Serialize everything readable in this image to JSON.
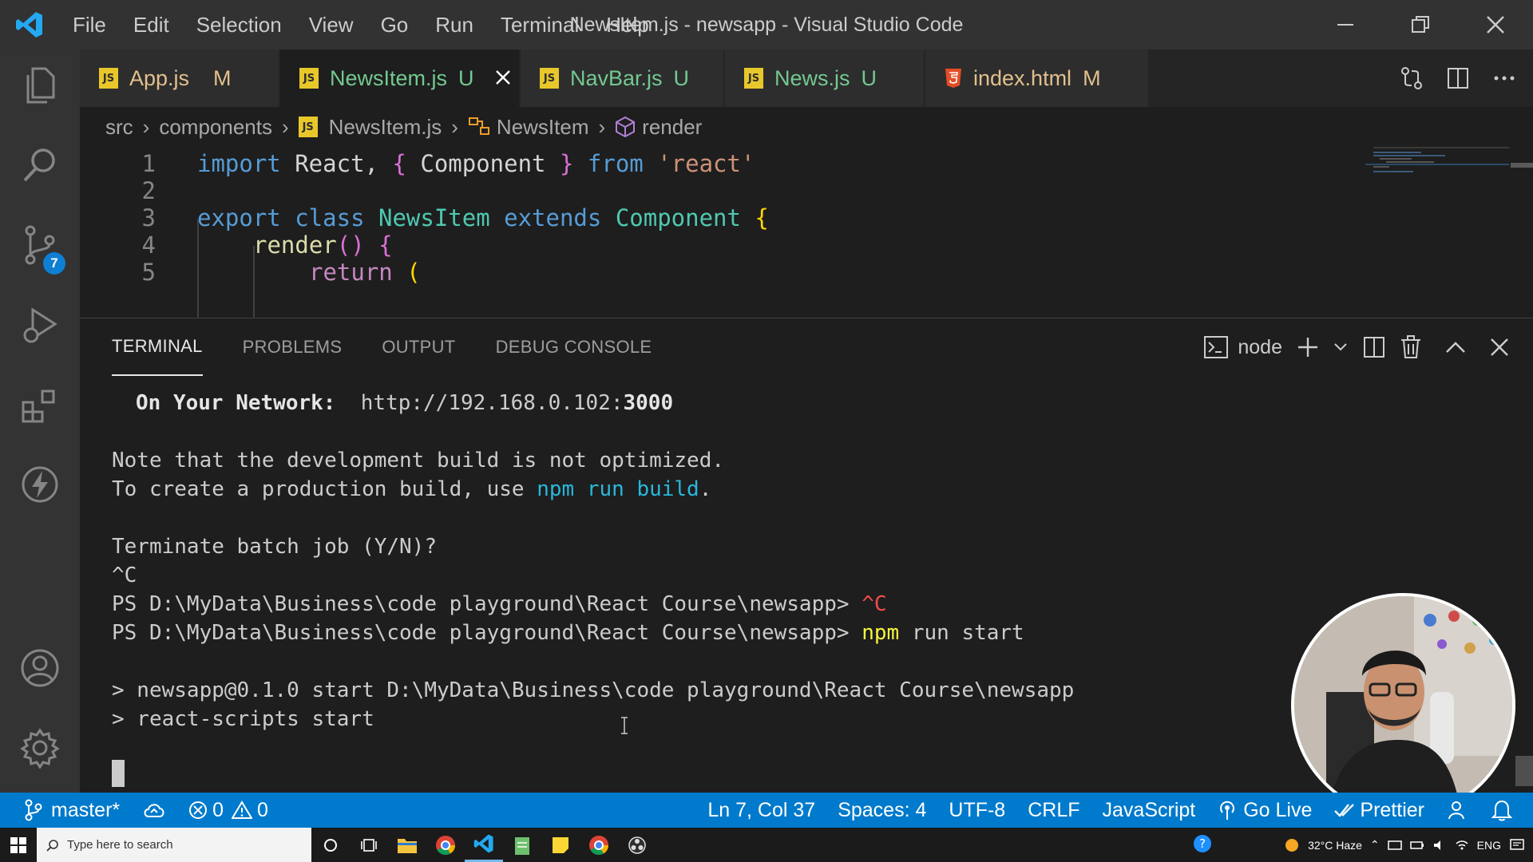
{
  "titlebar": {
    "menu": [
      "File",
      "Edit",
      "Selection",
      "View",
      "Go",
      "Run",
      "Terminal",
      "Help"
    ],
    "title": "NewsItem.js - newsapp - Visual Studio Code"
  },
  "activity": {
    "source_control_badge": "7"
  },
  "tabs": [
    {
      "name": "App.js",
      "status": "M"
    },
    {
      "name": "NewsItem.js",
      "status": "U"
    },
    {
      "name": "NavBar.js",
      "status": "U"
    },
    {
      "name": "News.js",
      "status": "U"
    },
    {
      "name": "index.html",
      "status": "M"
    }
  ],
  "breadcrumb": [
    "src",
    "components",
    "NewsItem.js",
    "NewsItem",
    "render"
  ],
  "code": {
    "line_numbers": [
      "1",
      "2",
      "3",
      "4",
      "5"
    ],
    "l1": {
      "import": "import",
      "mid": " React, ",
      "ob": "{",
      "comp": " Component ",
      "cb": "}",
      "from": " from ",
      "str": "'react'"
    },
    "l3": {
      "export": "export",
      "class": " class ",
      "name": "NewsItem",
      "extends": " extends ",
      "base": "Component",
      "brace": " {"
    },
    "l4": {
      "fn": "render",
      "parens": "()",
      "brace": " {"
    },
    "l5": {
      "ret": "return",
      "paren": " ("
    }
  },
  "panel": {
    "tabs": [
      "TERMINAL",
      "PROBLEMS",
      "OUTPUT",
      "DEBUG CONSOLE"
    ],
    "shell": "node"
  },
  "terminal": {
    "network_label": "On Your Network:",
    "network_url": "http://192.168.0.102:",
    "network_port": "3000",
    "note1": "Note that the development build is not optimized.",
    "note2_pre": "To create a production build, use ",
    "note2_cmd": "npm run build",
    "note2_post": ".",
    "terminate": "Terminate batch job (Y/N)?",
    "ctrl_c": "^C",
    "prompt": "PS D:\\MyData\\Business\\code playground\\React Course\\newsapp> ",
    "prompt_ctrl": "^C",
    "npm": "npm",
    "npm_rest": " run start",
    "script1": "> newsapp@0.1.0 start D:\\MyData\\Business\\code playground\\React Course\\newsapp",
    "script2": "> react-scripts start"
  },
  "statusbar": {
    "branch": "master*",
    "errors": "0",
    "warnings": "0",
    "position": "Ln 7, Col 37",
    "spaces": "Spaces: 4",
    "encoding": "UTF-8",
    "eol": "CRLF",
    "language": "JavaScript",
    "golive": "Go Live",
    "prettier": "Prettier"
  },
  "taskbar": {
    "search_placeholder": "Type here to search",
    "weather": "32°C Haze",
    "lang": "ENG"
  },
  "colors": {
    "accent": "#007acc",
    "titlebar": "#323233",
    "editor_bg": "#1e1e1e",
    "tab_modified": "#e2c08d",
    "tab_untracked": "#73c991"
  }
}
